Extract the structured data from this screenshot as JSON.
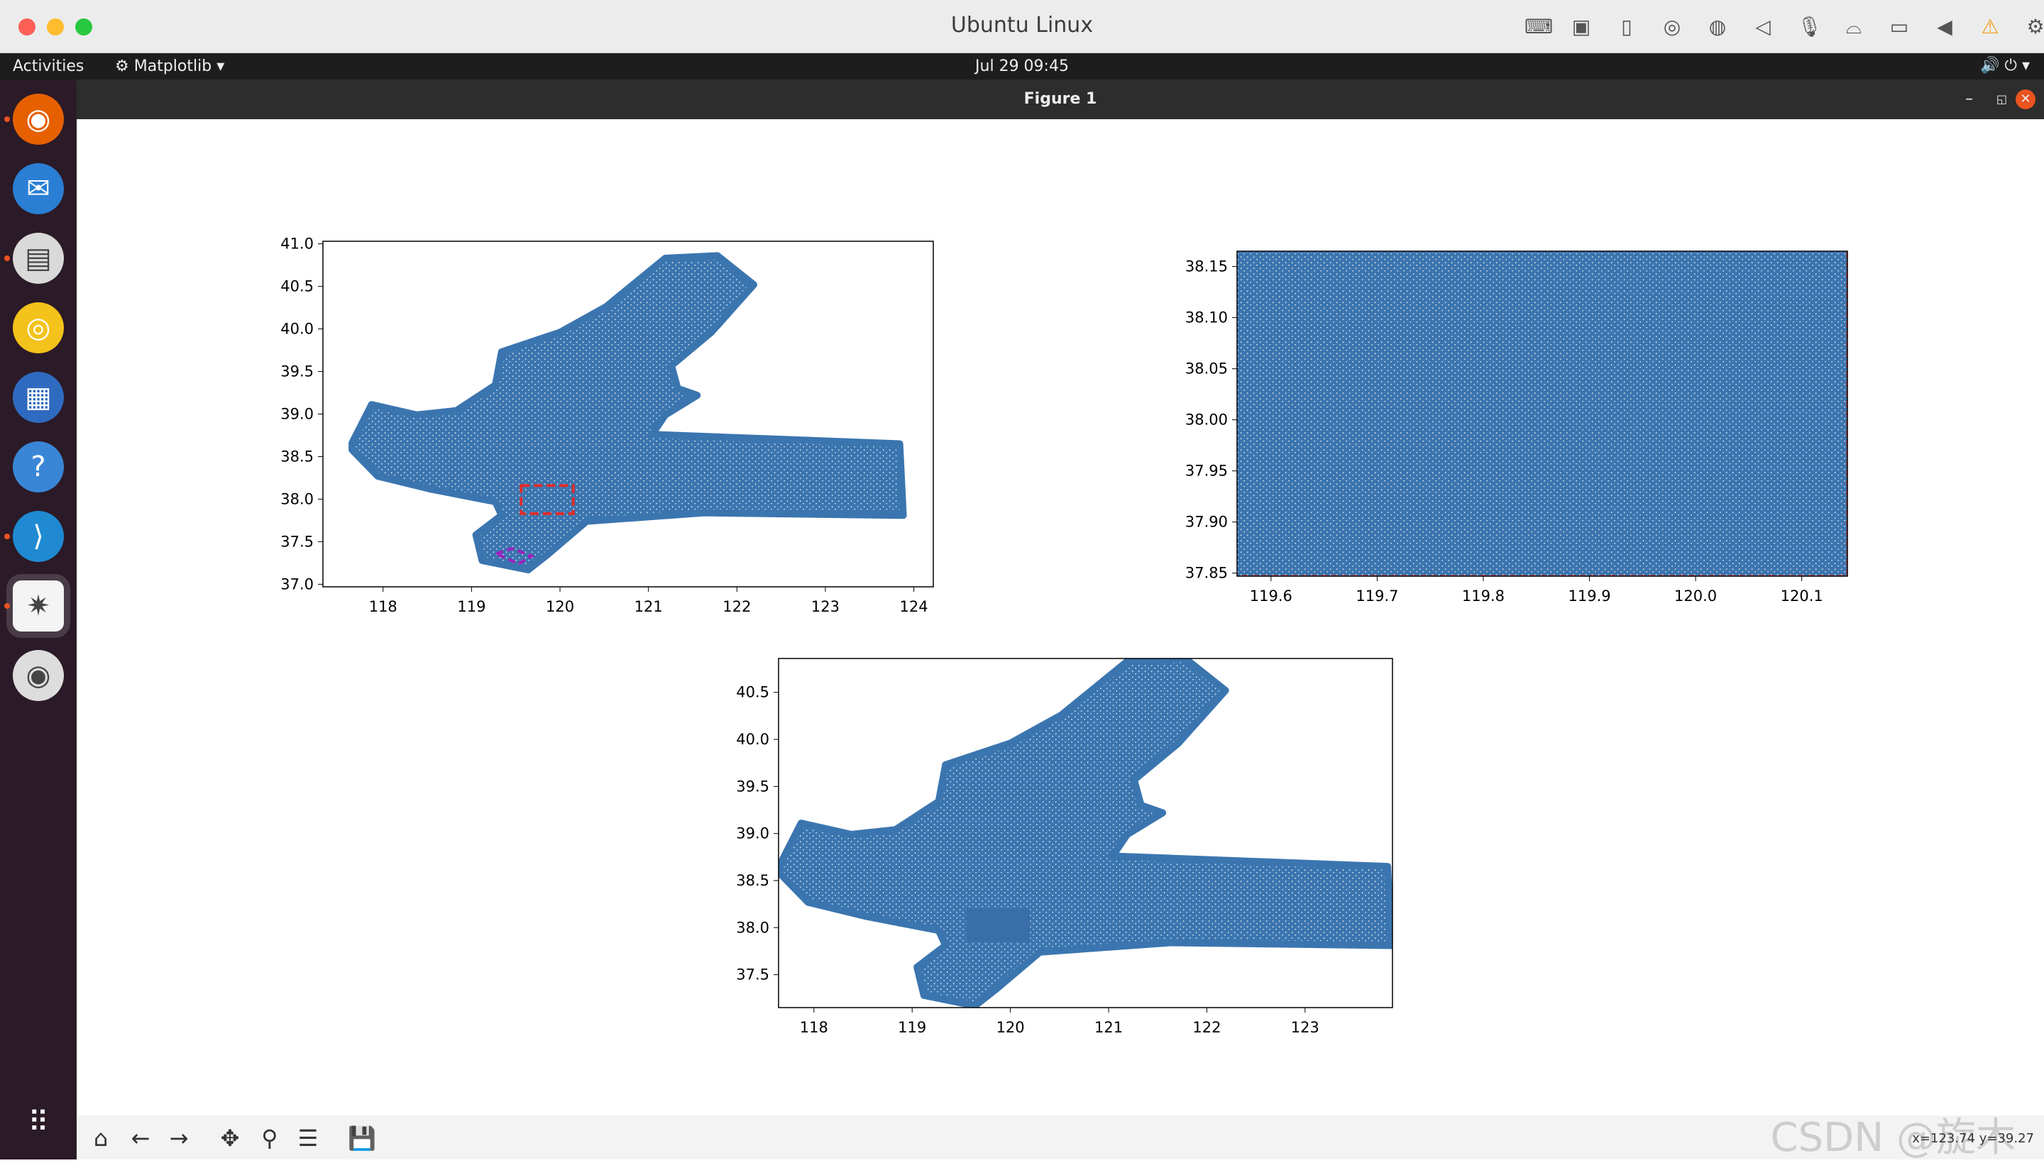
{
  "host": {
    "title": "Ubuntu Linux",
    "icons": [
      "keyboard-icon",
      "cpu-icon",
      "usb-icon",
      "disc-icon",
      "globe-icon",
      "speaker-icon",
      "microphone-icon",
      "drive-icon",
      "camera-icon",
      "arrow-icon",
      "warning-icon",
      "gear-icon"
    ]
  },
  "topbar": {
    "activities": "Activities",
    "app": "Matplotlib",
    "datetime": "Jul 29  09:45"
  },
  "dock": {
    "items": [
      "firefox",
      "thunderbird",
      "files",
      "rhythmbox",
      "writer",
      "help",
      "vscode",
      "matplotlib",
      "dvd"
    ],
    "colors": [
      "#e66000",
      "#2a7fd4",
      "#d9d9d9",
      "#f3c21b",
      "#2e6bc0",
      "#3a86d6",
      "#1f8ad2",
      "#f4f4f4",
      "#ddd"
    ]
  },
  "window": {
    "title": "Figure 1"
  },
  "toolbar": {
    "buttons": [
      "home",
      "back",
      "forward",
      "pan",
      "zoom",
      "configure",
      "save"
    ],
    "coords": "x=123.74 y=39.27",
    "watermark": "CSDN @旋木"
  },
  "chart_data": [
    {
      "type": "mesh",
      "xlim": [
        117.32,
        124.22
      ],
      "ylim": [
        36.97,
        41.03
      ],
      "xticks": [
        "118",
        "119",
        "120",
        "121",
        "122",
        "123",
        "124"
      ],
      "yticks": [
        "37.0",
        "37.5",
        "38.0",
        "38.5",
        "39.0",
        "39.5",
        "40.0",
        "40.5",
        "41.0"
      ],
      "outline": [
        [
          117.65,
          38.66
        ],
        [
          117.87,
          39.11
        ],
        [
          118.38,
          38.99
        ],
        [
          118.83,
          39.04
        ],
        [
          119.27,
          39.34
        ],
        [
          119.34,
          39.73
        ],
        [
          120.0,
          39.96
        ],
        [
          120.52,
          40.26
        ],
        [
          121.19,
          40.83
        ],
        [
          121.78,
          40.86
        ],
        [
          122.19,
          40.52
        ],
        [
          121.71,
          39.96
        ],
        [
          121.26,
          39.57
        ],
        [
          121.33,
          39.3
        ],
        [
          121.55,
          39.22
        ],
        [
          121.19,
          38.99
        ],
        [
          121.04,
          38.76
        ],
        [
          123.84,
          38.65
        ],
        [
          123.88,
          37.81
        ],
        [
          121.63,
          37.84
        ],
        [
          120.3,
          37.74
        ],
        [
          119.86,
          37.35
        ],
        [
          119.64,
          37.17
        ],
        [
          119.12,
          37.28
        ],
        [
          119.05,
          37.58
        ],
        [
          119.34,
          37.81
        ],
        [
          119.27,
          37.97
        ],
        [
          118.53,
          38.12
        ],
        [
          117.94,
          38.27
        ],
        [
          117.65,
          38.58
        ]
      ],
      "box": {
        "x": [
          119.56,
          120.15
        ],
        "y": [
          37.83,
          38.16
        ],
        "color": "#e02b2b"
      },
      "quad": {
        "points": [
          [
            119.28,
            37.36
          ],
          [
            119.46,
            37.42
          ],
          [
            119.68,
            37.33
          ],
          [
            119.53,
            37.24
          ]
        ],
        "color": "#a020c0"
      }
    },
    {
      "type": "mesh",
      "xlim": [
        119.568,
        120.143
      ],
      "ylim": [
        37.847,
        38.165
      ],
      "xticks": [
        "119.6",
        "119.7",
        "119.8",
        "119.9",
        "120.0",
        "120.1"
      ],
      "yticks": [
        "37.85",
        "37.90",
        "37.95",
        "38.00",
        "38.05",
        "38.10",
        "38.15"
      ],
      "full": true,
      "edge": "#e02b2b"
    },
    {
      "type": "mesh",
      "xlim": [
        117.64,
        123.89
      ],
      "ylim": [
        37.15,
        40.86
      ],
      "xticks": [
        "118",
        "119",
        "120",
        "121",
        "122",
        "123"
      ],
      "yticks": [
        "37.5",
        "38.0",
        "38.5",
        "39.0",
        "39.5",
        "40.0",
        "40.5"
      ],
      "solid": {
        "x": [
          119.55,
          120.2
        ],
        "y": [
          37.85,
          38.2
        ]
      }
    }
  ],
  "mesh_color": "#3b75af"
}
